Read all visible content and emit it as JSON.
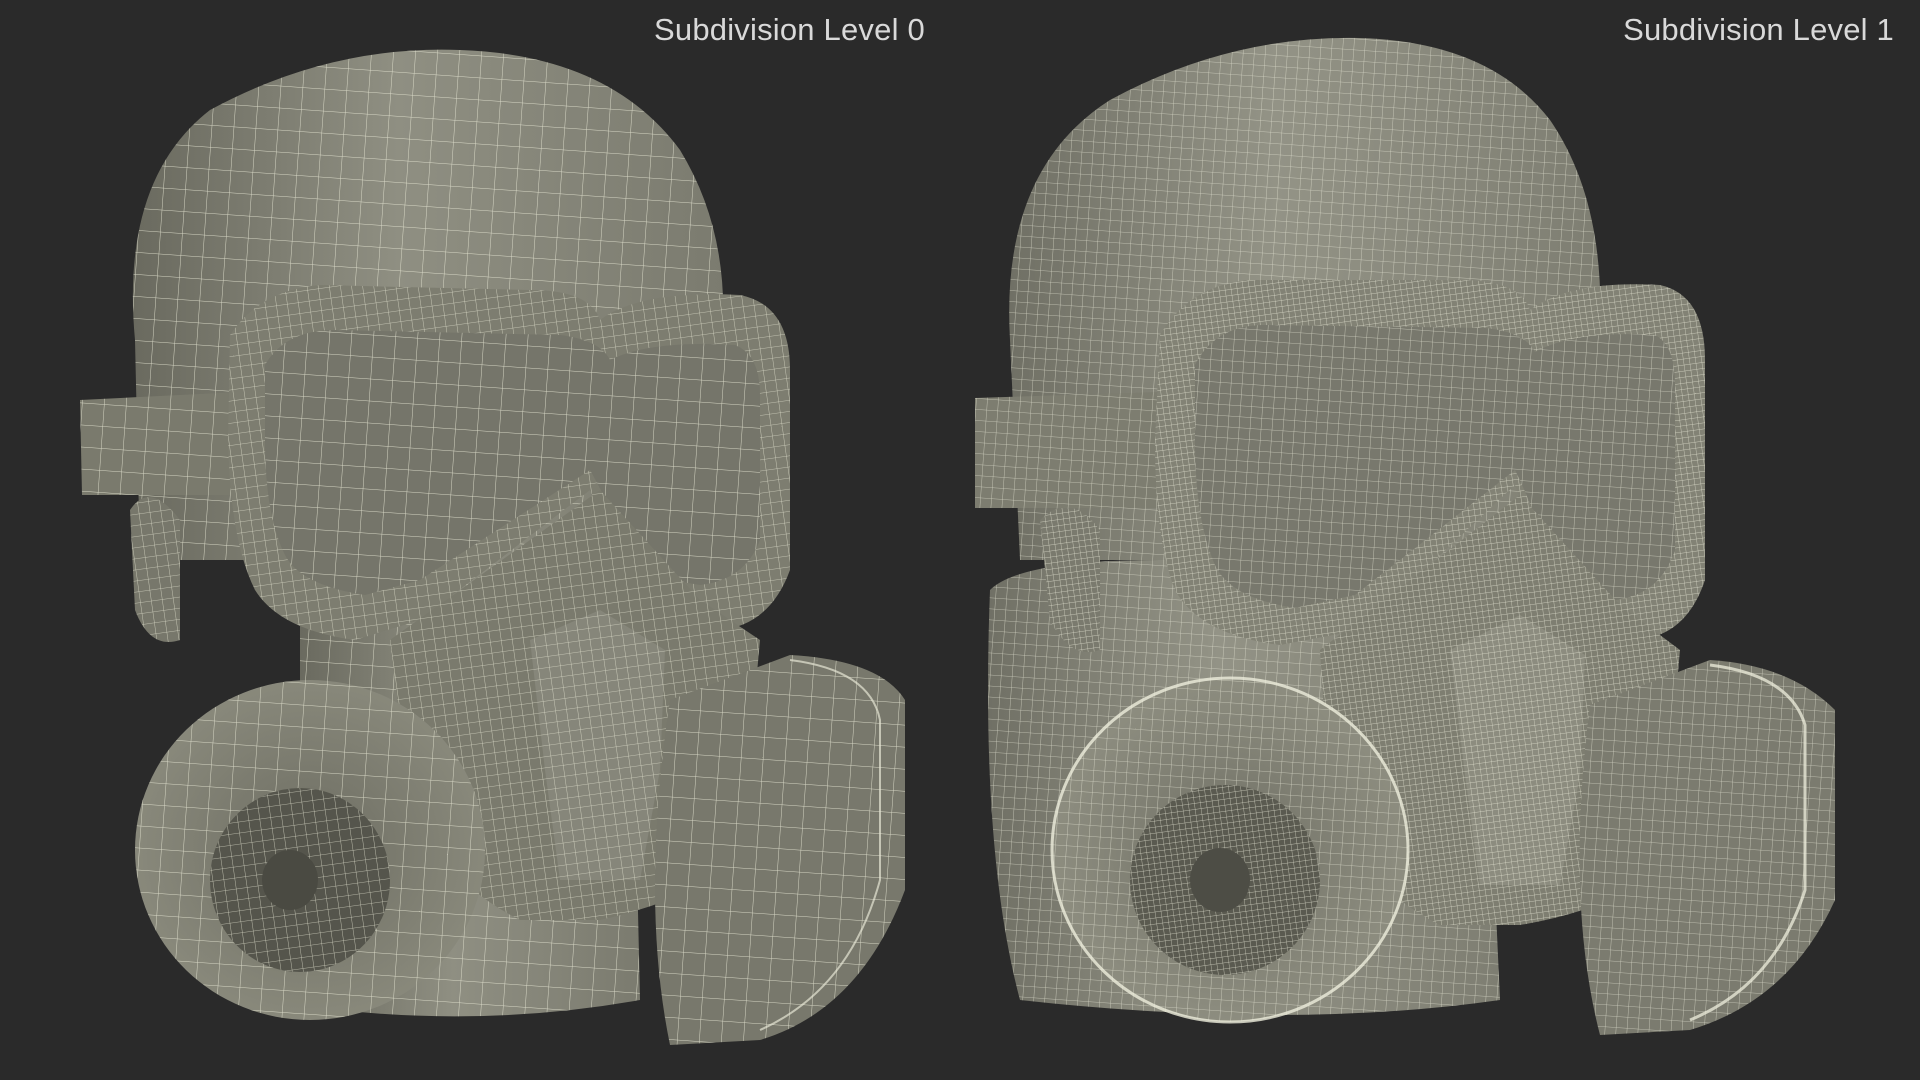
{
  "labels": {
    "left": "Subdivision Level 0",
    "right": "Subdivision Level 1"
  },
  "colors": {
    "background": "#2a2a2a",
    "surface": "#8a8a7c",
    "surface_light": "#a3a394",
    "surface_dark": "#5c5c52",
    "wire": "#e6e6d4",
    "label_text": "#d9d9d9"
  },
  "models": [
    {
      "subdivision_level": 0,
      "wire_density": 1
    },
    {
      "subdivision_level": 1,
      "wire_density": 2
    }
  ]
}
